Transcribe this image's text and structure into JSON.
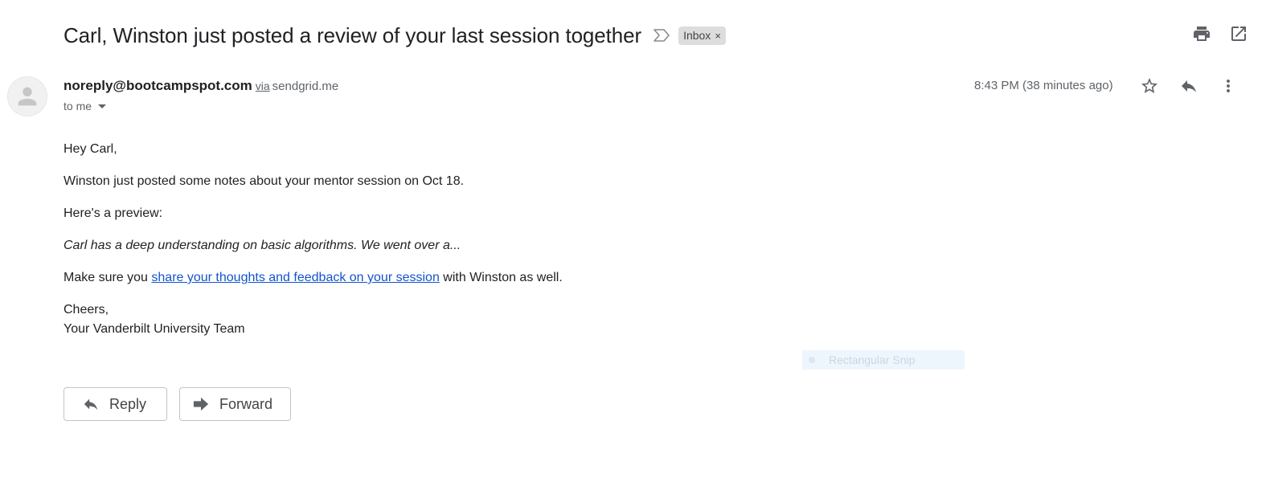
{
  "email": {
    "subject": "Carl, Winston just posted a review of your last session together",
    "label": "Inbox",
    "label_remove": "×",
    "sender": "noreply@bootcampspot.com",
    "via_text": "via",
    "via_domain": "sendgrid.me",
    "to_text": "to me",
    "timestamp": "8:43 PM (38 minutes ago)",
    "body": {
      "greeting": "Hey Carl,",
      "line1": "Winston just posted some notes about your mentor session on Oct 18.",
      "line2": "Here's a preview:",
      "preview": "Carl has a deep understanding on basic algorithms. We went over a...",
      "line3_before": "Make sure you ",
      "line3_link": "share your thoughts and feedback on your session",
      "line3_after": " with Winston as well.",
      "signoff": "Cheers,",
      "signature": "Your Vanderbilt University Team"
    }
  },
  "actions": {
    "reply_label": "Reply",
    "forward_label": "Forward"
  },
  "overlay": {
    "snip_label": "Rectangular Snip"
  },
  "icons": {
    "important": "important-marker-icon",
    "print": "print-icon",
    "open_new_window": "open-in-new-window-icon",
    "star": "star-icon",
    "reply": "reply-icon",
    "more": "more-vert-icon",
    "avatar": "person-icon",
    "forward": "forward-icon"
  },
  "colors": {
    "link": "#1155cc",
    "label_bg": "#dddddd",
    "muted_text": "#5f6368",
    "icon": "#5f6368"
  }
}
